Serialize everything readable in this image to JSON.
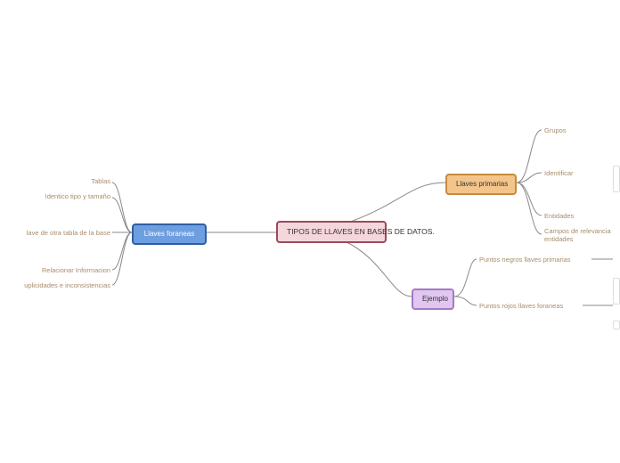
{
  "central": {
    "label": "TIPOS DE LLAVES EN BASES DE DATOS."
  },
  "foraneas": {
    "label": "Llaves foraneas",
    "children": [
      {
        "label": "Tablas"
      },
      {
        "label": "Identico tipo y tamaño"
      },
      {
        "label": "lave de otra tabla de la base"
      },
      {
        "label": "Relacionar Informacion"
      },
      {
        "label": "uplicidades e inconsistencias"
      }
    ]
  },
  "primarias": {
    "label": "Llaves primarias",
    "children": [
      {
        "label": "Grupos"
      },
      {
        "label": "Identificar"
      },
      {
        "label": "Entidades"
      },
      {
        "label": "Campos de relevancia\nentidades"
      }
    ]
  },
  "ejemplo": {
    "label": "Ejemplo",
    "children": [
      {
        "label": "Puntos negros llaves primarias"
      },
      {
        "label": "Puntos rojos llaves foraneas"
      }
    ]
  },
  "colors": {
    "connector": "#888"
  }
}
